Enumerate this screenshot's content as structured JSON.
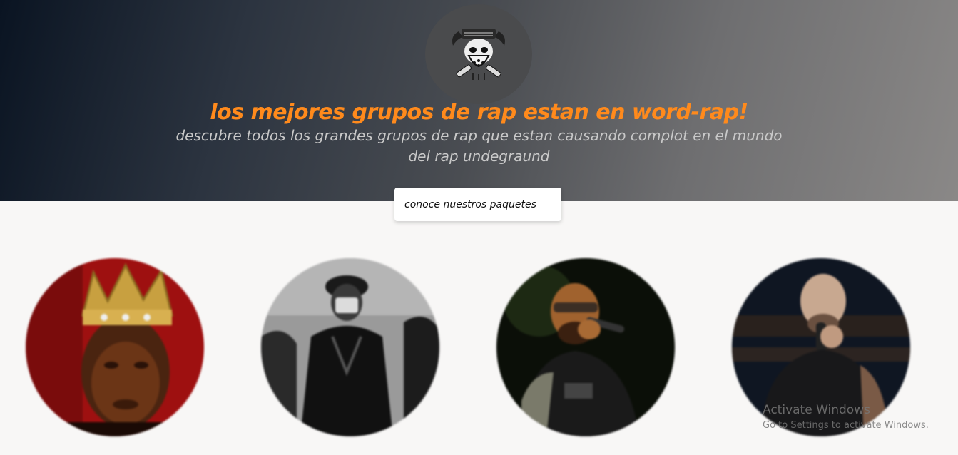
{
  "hero": {
    "logo_icon": "skull-gasmask-logo-icon",
    "title": "los mejores grupos de rap estan en word-rap!",
    "subtitle": "descubre todos los grandes grupos de rap que estan causando complot en el mundo del rap undegraund",
    "cta_label": "conoce nuestros paquetes",
    "title_color": "#ff8a1c"
  },
  "artists": [
    {
      "icon": "crowned-rapper-photo"
    },
    {
      "icon": "masked-group-photo"
    },
    {
      "icon": "rapper-with-mic-photo"
    },
    {
      "icon": "bald-rapper-with-mic-photo"
    }
  ],
  "watermark": {
    "line1": "Activate Windows",
    "line2": "Go to Settings to activate Windows."
  }
}
